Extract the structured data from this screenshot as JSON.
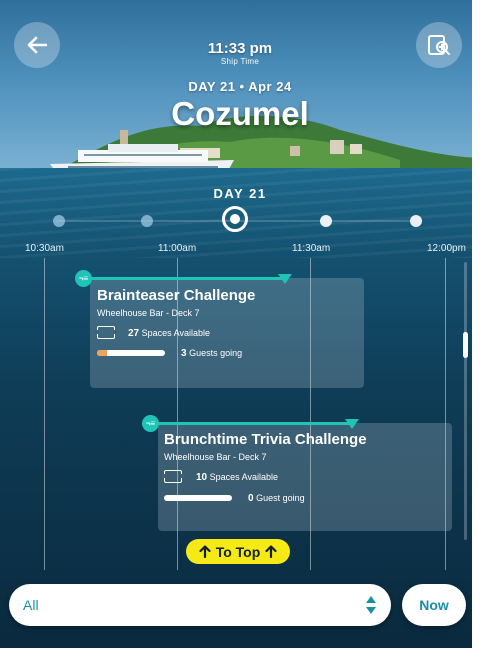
{
  "header": {
    "time": "11:33 pm",
    "time_label": "Ship Time",
    "day_date": "DAY 21 • Apr 24",
    "port": "Cozumel",
    "back_icon": "arrow-left-icon",
    "search_icon": "calendar-search-icon"
  },
  "day_selector": {
    "label": "DAY 21",
    "selected_index": 2,
    "day_count": 5
  },
  "timeline": {
    "ticks": [
      "10:30am",
      "11:00am",
      "11:30am",
      "12:00pm"
    ]
  },
  "events": [
    {
      "title": "Brainteaser Challenge",
      "venue": "Wheelhouse Bar  - Deck 7",
      "spaces_count": "27",
      "spaces_text": "Spaces Available",
      "guests_count": "3",
      "guests_text": "Guests going",
      "guest_fill": 0.15,
      "handle_text": "¬≡"
    },
    {
      "title": "Brunchtime Trivia Challenge",
      "venue": "Wheelhouse Bar  - Deck 7",
      "spaces_count": "10",
      "spaces_text": "Spaces Available",
      "guests_count": "0",
      "guests_text": "Guest going",
      "guest_fill": 0,
      "handle_text": "¬≡"
    }
  ],
  "to_top": {
    "label": "To Top",
    "icon": "arrow-up-icon"
  },
  "filter": {
    "value": "All",
    "icon": "sort-arrows-icon"
  },
  "now_button": {
    "label": "Now"
  },
  "colors": {
    "accent": "#1fc4b7",
    "to_top_bg": "#f5ea16",
    "link_text": "#1a8fa6",
    "guest_fill": "#f0a25a"
  }
}
